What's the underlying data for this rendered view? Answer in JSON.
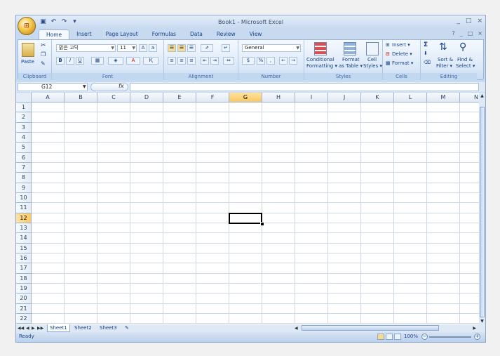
{
  "window": {
    "title": "Book1 - Microsoft Excel",
    "controls": [
      "_",
      "□",
      "×"
    ]
  },
  "office_button": {
    "label": "⊞"
  },
  "ribbon_tabs": [
    "Home",
    "Insert",
    "Page Layout",
    "Formulas",
    "Data",
    "Review",
    "View"
  ],
  "ribbon_right_controls": [
    "?",
    "_",
    "□",
    "×"
  ],
  "groups": {
    "clipboard": {
      "label": "Clipboard",
      "paste": "Paste"
    },
    "font": {
      "label": "Font",
      "font_name": "맑은 고딕",
      "font_size": "11",
      "bold": "B",
      "italic": "I",
      "underline": "U"
    },
    "alignment": {
      "label": "Alignment"
    },
    "number": {
      "label": "Number",
      "format": "General",
      "percent": "%",
      "comma": ","
    },
    "styles": {
      "label": "Styles",
      "conditional": "Conditional",
      "conditional2": "Formatting ▾",
      "format_table": "Format",
      "format_table2": "as Table ▾",
      "cell_styles": "Cell",
      "cell_styles2": "Styles ▾"
    },
    "cells": {
      "label": "Cells",
      "insert": "Insert ▾",
      "delete": "Delete ▾",
      "format": "Format ▾"
    },
    "editing": {
      "label": "Editing",
      "sort": "Sort &",
      "sort2": "Filter ▾",
      "find": "Find &",
      "find2": "Select ▾"
    }
  },
  "formula_bar": {
    "name_box": "G12",
    "fx": "fx",
    "formula": ""
  },
  "grid": {
    "columns": [
      "A",
      "B",
      "C",
      "D",
      "E",
      "F",
      "G",
      "H",
      "I",
      "J",
      "K",
      "L",
      "M",
      "N"
    ],
    "rows": [
      "1",
      "2",
      "3",
      "4",
      "5",
      "6",
      "7",
      "8",
      "9",
      "10",
      "11",
      "12",
      "13",
      "14",
      "15",
      "16",
      "17",
      "18",
      "19",
      "20",
      "21",
      "22"
    ],
    "active_column": "G",
    "active_row": "12"
  },
  "sheet_tabs": [
    "Sheet1",
    "Sheet2",
    "Sheet3"
  ],
  "active_sheet": "Sheet1",
  "status": {
    "ready": "Ready",
    "zoom": "100%"
  }
}
